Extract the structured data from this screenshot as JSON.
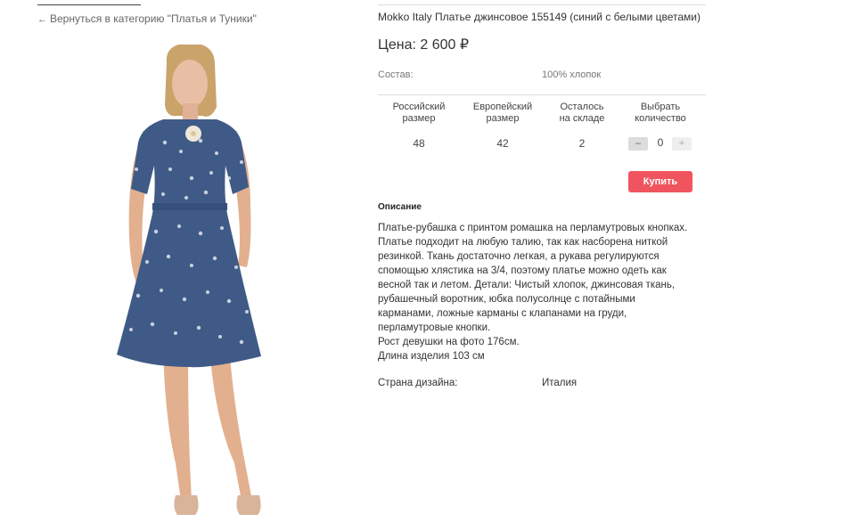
{
  "nav": {
    "back_arrow": "←",
    "back_label": "Вернуться в категорию \"Платья и Туники\""
  },
  "product": {
    "title": "Mokko Italy Платье джинсовое 155149 (синий с белыми цветами)",
    "price_label": "Цена: 2 600",
    "currency_symbol": "₽",
    "composition_label": "Состав:",
    "composition_value": "100% хлопок",
    "image_icon": "woman-in-denim-dress-photo"
  },
  "sizes": {
    "headers": [
      [
        "Российский",
        "размер"
      ],
      [
        "Европейский",
        "размер"
      ],
      [
        "Осталось",
        "на складе"
      ],
      [
        "Выбрать",
        "количество"
      ]
    ],
    "russian": "48",
    "european": "42",
    "stock": "2",
    "quantity": "0",
    "minus": "–",
    "plus": "+"
  },
  "buy_label": "Купить",
  "description": {
    "title": "Описание",
    "lines": [
      "Платье-рубашка с принтом ромашка  на перламутровых кнопках.",
      "Платье подходит на любую талию, так как насборена ниткой",
      "резинкой. Ткань достаточно легкая, а рукава  регулируются",
      "спомощью хлястика на 3/4, поэтому платье можно одеть как",
      "весной так и летом.  Детали: Чистый хлопок, джинсовая ткань,",
      "рубашечный воротник, юбка полусолнце с потайными",
      "карманами, ложные карманы с клапанами на груди,",
      "перламутровые кнопки.",
      "Рост девушки на фото 176см.",
      "Длина изделия 103 см"
    ]
  },
  "country": {
    "label": "Страна дизайна:",
    "value": "Италия"
  },
  "colors": {
    "buy_button": "#f0555f",
    "dress": "#3f5a86",
    "text": "#333333"
  }
}
